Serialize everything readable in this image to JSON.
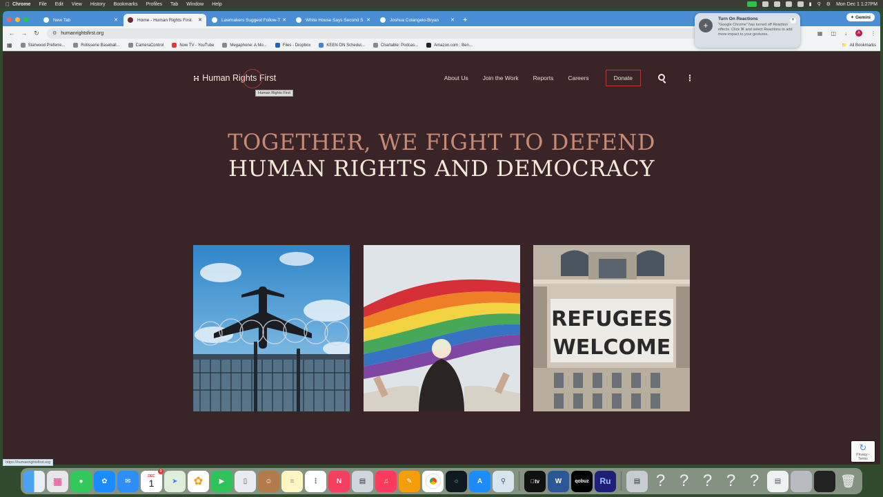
{
  "menubar": {
    "app_name": "Chrome",
    "items": [
      "File",
      "Edit",
      "View",
      "History",
      "Bookmarks",
      "Profiles",
      "Tab",
      "Window",
      "Help"
    ],
    "datetime": "Mon Dec 1  1:27PM"
  },
  "browser": {
    "tabs": [
      {
        "title": "New Tab",
        "active": false
      },
      {
        "title": "Home - Human Rights First",
        "active": true
      },
      {
        "title": "Lawmakers Suggest Follow-T",
        "active": false
      },
      {
        "title": "White House Says Second S",
        "active": false
      },
      {
        "title": "Joshua Colangelo-Bryan",
        "active": false
      }
    ],
    "gemini_label": "Gemini",
    "url": "humanrightsfirst.org",
    "bookmarks": [
      "Starwood Preferre...",
      "Rotisserie Baseball...",
      "CameraControl",
      "Now TV - YouTube",
      "Megaphone: A Mo...",
      "Files - Dropbox",
      "KEEN ON Schedul...",
      "Chartable: Podcas...",
      "Amazon.com : Ben..."
    ],
    "all_bookmarks_label": "All Bookmarks",
    "status_url": "https://humanrightsfirst.org"
  },
  "notification": {
    "title": "Turn On Reactions",
    "body": "\"Google Chrome\" has turned off Reaction effects. Click ⌘ and select Reactions to add more impact to your gestures."
  },
  "site": {
    "logo_text": "Human Rights First",
    "tooltip": "Human Rights First",
    "nav": [
      "About Us",
      "Join the Work",
      "Reports",
      "Careers"
    ],
    "donate_label": "Donate",
    "hero_line1": "TOGETHER, WE FIGHT TO DEFEND",
    "hero_line2": "HUMAN RIGHTS AND DEMOCRACY",
    "cards": [
      {
        "subject": "airplane over barbed wire fence"
      },
      {
        "subject": "person holding rainbow flag"
      },
      {
        "subject": "refugees welcome banner",
        "sign_line1": "REFUGEES",
        "sign_line2": "WELCOME"
      }
    ],
    "recaptcha_label": "Privacy - Terms"
  },
  "dock": {
    "calendar_month": "DEC",
    "calendar_day": "1",
    "calendar_badge": "3",
    "tv_label": "tv",
    "word_label": "W",
    "qobuz_label": "qobuz",
    "ru_label": "Ru"
  },
  "colors": {
    "page_bg": "#392528",
    "hero_accent": "#c98a74",
    "hero_light": "#f3e9d9",
    "donate_border": "#b33a3a",
    "tab_bar": "#4a8ed6"
  }
}
